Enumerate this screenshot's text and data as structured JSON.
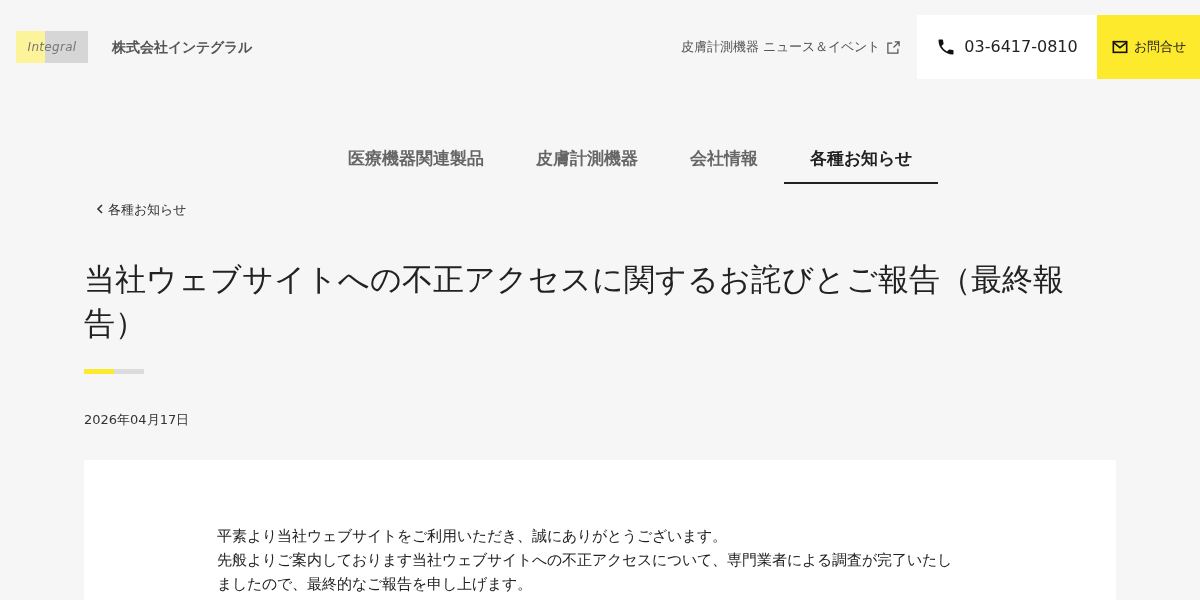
{
  "header": {
    "logo": "Integral",
    "company": "株式会社インテグラル",
    "news_link": "皮膚計測機器 ニュース＆イベント",
    "phone": "03-6417-0810",
    "contact": "お問合せ"
  },
  "nav": [
    {
      "label": "医療機器関連製品",
      "selected": false
    },
    {
      "label": "皮膚計測機器",
      "selected": false
    },
    {
      "label": "会社情報",
      "selected": false
    },
    {
      "label": "各種お知らせ",
      "selected": true
    }
  ],
  "breadcrumb": "各種お知らせ",
  "article": {
    "title": "当社ウェブサイトへの不正アクセスに関するお詫びとご報告（最終報告）",
    "date": "2026年04月17日",
    "paragraphs": [
      "平素より当社ウェブサイトをご利用いただき、誠にありがとうございます。",
      "先般よりご案内しております当社ウェブサイトへの不正アクセスについて、専門業者による調査が完了いたしましたので、最終的なご報告を申し上げます。"
    ]
  }
}
